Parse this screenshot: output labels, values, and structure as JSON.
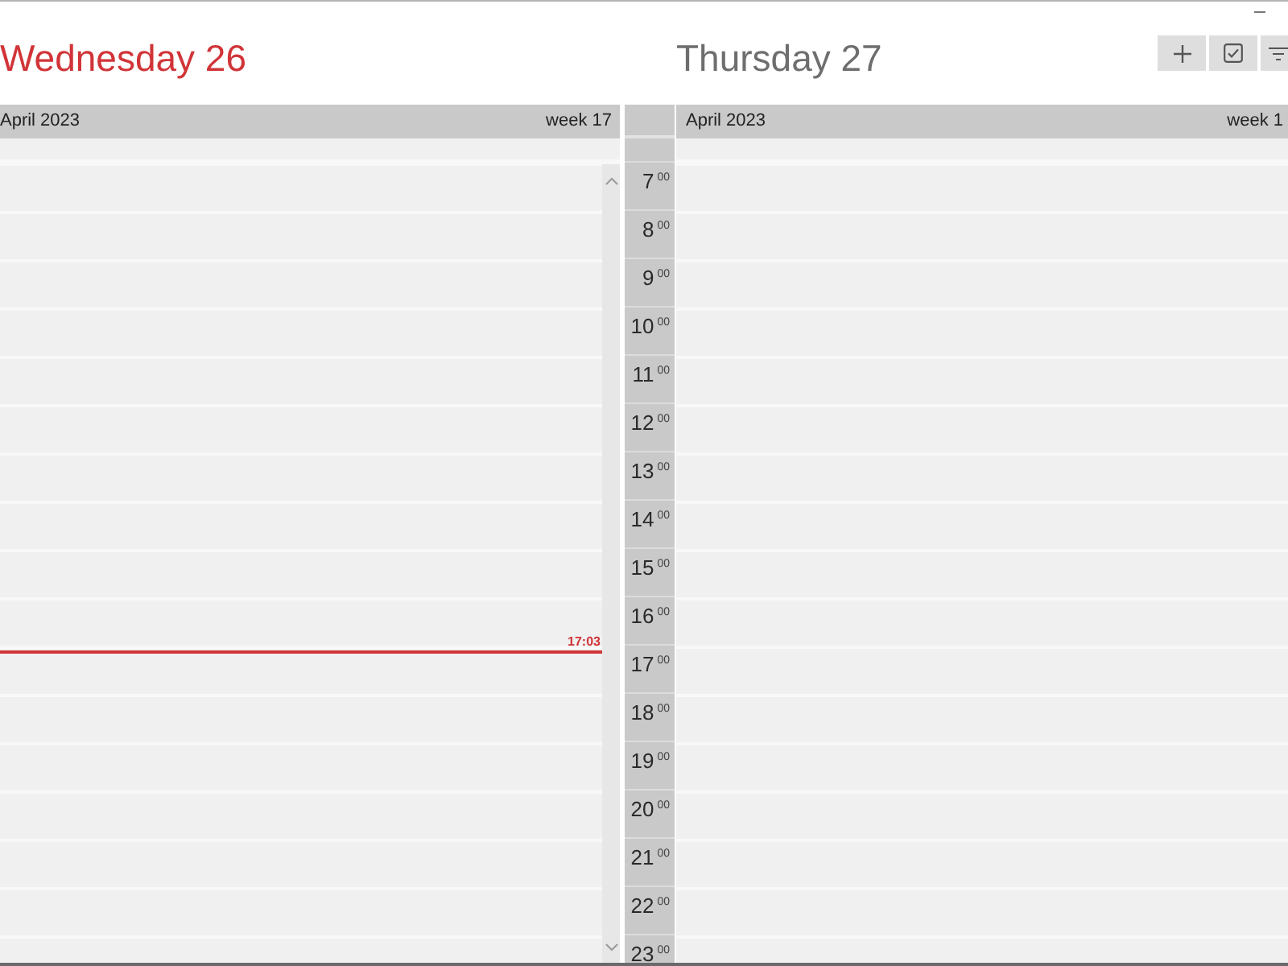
{
  "window": {
    "controls": [
      {
        "kind": "minimize"
      }
    ]
  },
  "toolbar": {
    "buttons": [
      {
        "kind": "add"
      },
      {
        "kind": "task"
      },
      {
        "kind": "filter"
      }
    ]
  },
  "days": [
    {
      "title": "Wednesday 26",
      "today": true,
      "month": "April 2023",
      "week": "week 17",
      "scrollbar": true,
      "now_line": {
        "label": "17:03"
      }
    },
    {
      "title": "Thursday 27",
      "today": false,
      "month": "April 2023",
      "week": "week 1"
    }
  ],
  "time_column": {
    "hours": [
      "7$^{00}$",
      "8$^{00}$",
      "9$^{00}$",
      "10$^{00}$",
      "11$^{00}$",
      "12$^{00}$",
      "13$^{00}$",
      "14$^{00}$",
      "15$^{00}$",
      "16$^{00}$",
      "17$^{00}$",
      "18$^{00}$",
      "19$^{00}$",
      "20$^{00}$",
      "21$^{00}$",
      "22$^{00}$",
      "23$^{00}$"
    ]
  }
}
